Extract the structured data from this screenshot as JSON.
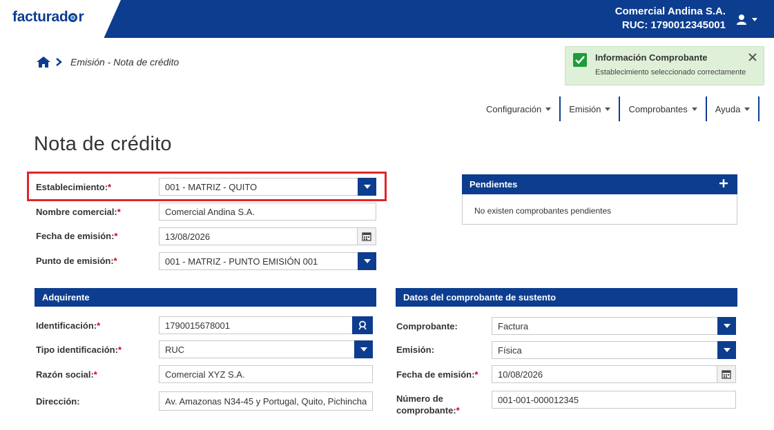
{
  "header": {
    "logo": "facturad⚪r",
    "company_name": "Comercial Andina S.A.",
    "ruc": "RUC: 1790012345001"
  },
  "breadcrumb": {
    "current": "Emisión - Nota de crédito"
  },
  "toast": {
    "title": "Información Comprobante",
    "message": "Establecimiento seleccionado correctamente"
  },
  "nav": {
    "items": [
      {
        "label": "Configuración"
      },
      {
        "label": "Emisión"
      },
      {
        "label": "Comprobantes"
      },
      {
        "label": "Ayuda"
      }
    ]
  },
  "page": {
    "title": "Nota de crédito"
  },
  "form": {
    "establecimiento": {
      "label": "Establecimiento:",
      "value": "001 - MATRIZ - QUITO"
    },
    "nombre_comercial": {
      "label": "Nombre comercial:",
      "value": "Comercial Andina S.A."
    },
    "fecha_emision": {
      "label": "Fecha de emisión:",
      "value": "13/08/2026"
    },
    "punto_emision": {
      "label": "Punto de emisión:",
      "value": "001 - MATRIZ - PUNTO EMISIÓN 001"
    }
  },
  "pendientes": {
    "title": "Pendientes",
    "empty": "No existen comprobantes pendientes"
  },
  "adquirente": {
    "title": "Adquirente",
    "identificacion": {
      "label": "Identificación:",
      "value": "1790015678001"
    },
    "tipo_identificacion": {
      "label": "Tipo identificación:",
      "value": "RUC"
    },
    "razon_social": {
      "label": "Razón social:",
      "value": "Comercial XYZ S.A."
    },
    "direccion": {
      "label": "Dirección:",
      "value": "Av. Amazonas N34-45 y Portugal, Quito, Pichincha"
    }
  },
  "sustento": {
    "title": "Datos del comprobante de sustento",
    "comprobante": {
      "label": "Comprobante:",
      "value": "Factura"
    },
    "emision": {
      "label": "Emisión:",
      "value": "Física"
    },
    "fecha_emision": {
      "label": "Fecha de emisión:",
      "value": "10/08/2026"
    },
    "numero_comprobante": {
      "label_1": "Número de",
      "label_2": "comprobante:",
      "value": "001-001-000012345"
    }
  },
  "colors": {
    "primary": "#0d3d8f",
    "success": "#1e9c3a",
    "toast_bg": "#dff0d8",
    "required": "#d0021b",
    "highlight": "#e0242b"
  }
}
